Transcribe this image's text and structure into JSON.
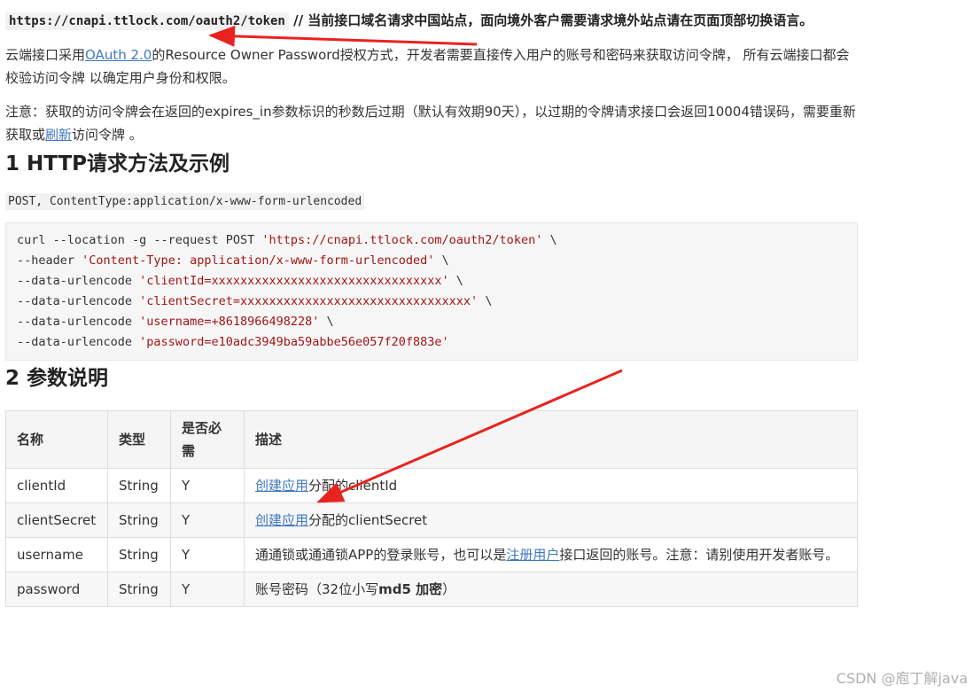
{
  "endpoint": {
    "url": "https://cnapi.ttlock.com/oauth2/token",
    "note": "  // 当前接口域名请求中国站点，面向境外客户需要请求境外站点请在页面顶部切换语言。"
  },
  "intro": {
    "prefix": "云端接口采用",
    "link": "OAuth 2.0",
    "suffix": "的Resource Owner Password授权方式，开发者需要直接传入用户的账号和密码来获取访问令牌， 所有云端接口都会校验访问令牌 以确定用户身份和权限。"
  },
  "notice": {
    "prefix": "注意：获取的访问令牌会在返回的expires_in参数标识的秒数后过期（默认有效期90天），以过期的令牌请求接口会返回10004错误码，需要重新获取或",
    "link": "刷新",
    "suffix": "访问令牌 。"
  },
  "section1": {
    "title": "1 HTTP请求方法及示例",
    "method": "POST, ContentType:application/x-www-form-urlencoded"
  },
  "code": [
    {
      "plain": "curl --location -g --request POST ",
      "str": "'https://cnapi.ttlock.com/oauth2/token'",
      "tail": " \\"
    },
    {
      "plain": "--header ",
      "str": "'Content-Type: application/x-www-form-urlencoded'",
      "tail": " \\"
    },
    {
      "plain": "--data-urlencode ",
      "str": "'clientId=xxxxxxxxxxxxxxxxxxxxxxxxxxxxxxxx'",
      "tail": " \\"
    },
    {
      "plain": "--data-urlencode ",
      "str": "'clientSecret=xxxxxxxxxxxxxxxxxxxxxxxxxxxxxxxx'",
      "tail": " \\"
    },
    {
      "plain": "--data-urlencode ",
      "str": "'username=+8618966498228'",
      "tail": " \\"
    },
    {
      "plain": "--data-urlencode ",
      "str": "'password=e10adc3949ba59abbe56e057f20f883e'",
      "tail": ""
    }
  ],
  "section2": {
    "title": "2 参数说明",
    "headers": [
      "名称",
      "类型",
      "是否必需",
      "描述"
    ],
    "rows": [
      {
        "name": "clientId",
        "type": "String",
        "required": "Y",
        "desc_link": "创建应用",
        "desc_text": "分配的clientId",
        "desc_rest": ""
      },
      {
        "name": "clientSecret",
        "type": "String",
        "required": "Y",
        "desc_link": "创建应用",
        "desc_text": "分配的clientSecret",
        "desc_rest": ""
      },
      {
        "name": "username",
        "type": "String",
        "required": "Y",
        "desc_pre": "通通锁或通通锁APP的登录账号，也可以是",
        "desc_link": "注册用户",
        "desc_text": "接口返回的账号。注意：请别使用开发者账号。"
      },
      {
        "name": "password",
        "type": "String",
        "required": "Y",
        "desc_pre": "账号密码（32位小写",
        "desc_bold": "md5 加密",
        "desc_text": "）"
      }
    ]
  },
  "watermark": "CSDN @庖丁解java",
  "colors": {
    "link": "#4078c0",
    "annotation_arrow": "#e8231f",
    "code_string": "#a31515"
  }
}
